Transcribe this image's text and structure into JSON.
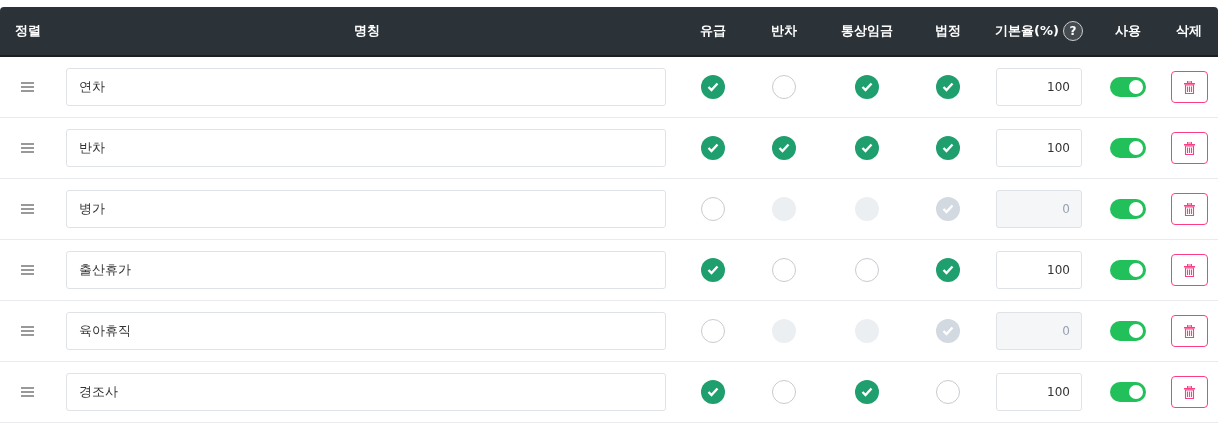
{
  "table": {
    "columns": [
      {
        "label": "정렬"
      },
      {
        "label": "명칭"
      },
      {
        "label": "유급"
      },
      {
        "label": "반차"
      },
      {
        "label": "통상임금"
      },
      {
        "label": "법정"
      },
      {
        "label": "기본율(%)",
        "help": "?"
      },
      {
        "label": "사용"
      },
      {
        "label": "삭제"
      }
    ],
    "rows": [
      {
        "name": "연차",
        "checks": [
          {
            "checked": true,
            "disabled": false
          },
          {
            "checked": false,
            "disabled": false
          },
          {
            "checked": true,
            "disabled": false
          },
          {
            "checked": true,
            "disabled": false
          }
        ],
        "rate": {
          "value": "100",
          "disabled": false
        },
        "enabled": true
      },
      {
        "name": "반차",
        "checks": [
          {
            "checked": true,
            "disabled": false
          },
          {
            "checked": true,
            "disabled": false
          },
          {
            "checked": true,
            "disabled": false
          },
          {
            "checked": true,
            "disabled": false
          }
        ],
        "rate": {
          "value": "100",
          "disabled": false
        },
        "enabled": true
      },
      {
        "name": "병가",
        "checks": [
          {
            "checked": false,
            "disabled": false
          },
          {
            "checked": false,
            "disabled": true
          },
          {
            "checked": false,
            "disabled": true
          },
          {
            "checked": true,
            "disabled": true
          }
        ],
        "rate": {
          "value": "0",
          "disabled": true
        },
        "enabled": true
      },
      {
        "name": "출산휴가",
        "checks": [
          {
            "checked": true,
            "disabled": false
          },
          {
            "checked": false,
            "disabled": false
          },
          {
            "checked": false,
            "disabled": false
          },
          {
            "checked": true,
            "disabled": false
          }
        ],
        "rate": {
          "value": "100",
          "disabled": false
        },
        "enabled": true
      },
      {
        "name": "육아휴직",
        "checks": [
          {
            "checked": false,
            "disabled": false
          },
          {
            "checked": false,
            "disabled": true
          },
          {
            "checked": false,
            "disabled": true
          },
          {
            "checked": true,
            "disabled": true
          }
        ],
        "rate": {
          "value": "0",
          "disabled": true
        },
        "enabled": true
      },
      {
        "name": "경조사",
        "checks": [
          {
            "checked": true,
            "disabled": false
          },
          {
            "checked": false,
            "disabled": false
          },
          {
            "checked": true,
            "disabled": false
          },
          {
            "checked": false,
            "disabled": false
          }
        ],
        "rate": {
          "value": "100",
          "disabled": false
        },
        "enabled": true
      }
    ]
  }
}
